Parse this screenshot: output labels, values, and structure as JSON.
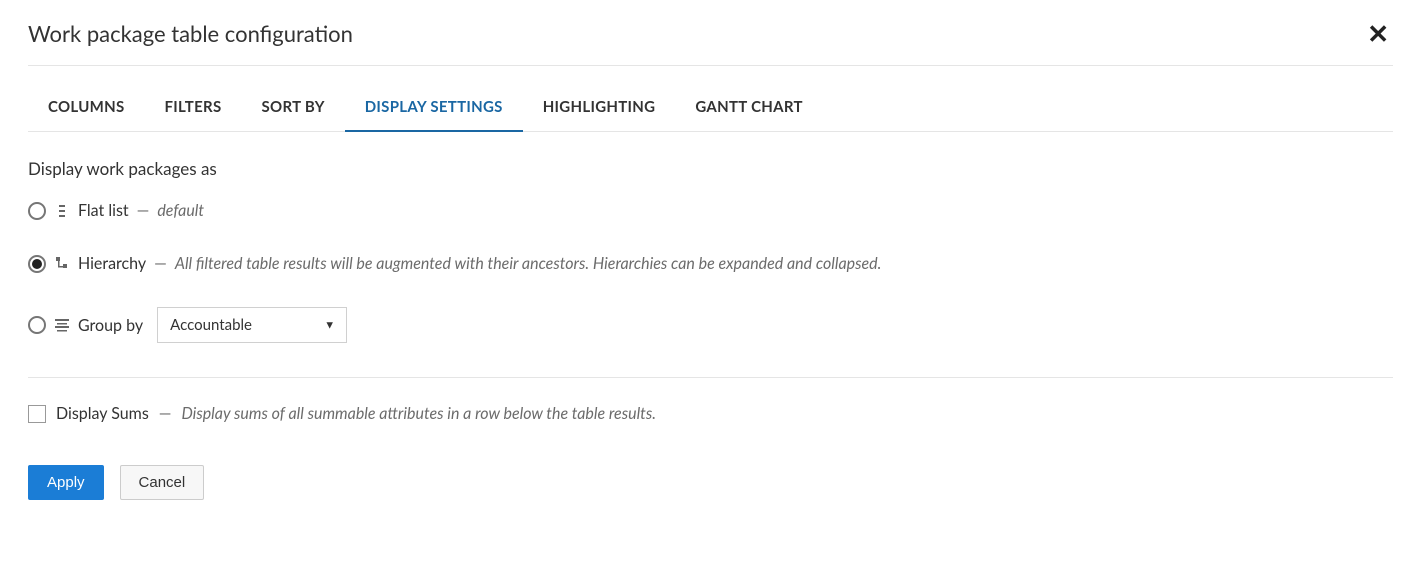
{
  "title": "Work package table configuration",
  "tabs": {
    "columns": "COLUMNS",
    "filters": "FILTERS",
    "sort_by": "SORT BY",
    "display_settings": "DISPLAY SETTINGS",
    "highlighting": "HIGHLIGHTING",
    "gantt_chart": "GANTT CHART"
  },
  "section_label": "Display work packages as",
  "options": {
    "flat_list": {
      "label": "Flat list",
      "hint": "default"
    },
    "hierarchy": {
      "label": "Hierarchy",
      "hint": "All filtered table results will be augmented with their ancestors. Hierarchies can be expanded and collapsed."
    },
    "group_by": {
      "label": "Group by",
      "selected": "Accountable"
    }
  },
  "display_sums": {
    "label": "Display Sums",
    "hint": "Display sums of all summable attributes in a row below the table results."
  },
  "actions": {
    "apply": "Apply",
    "cancel": "Cancel"
  }
}
